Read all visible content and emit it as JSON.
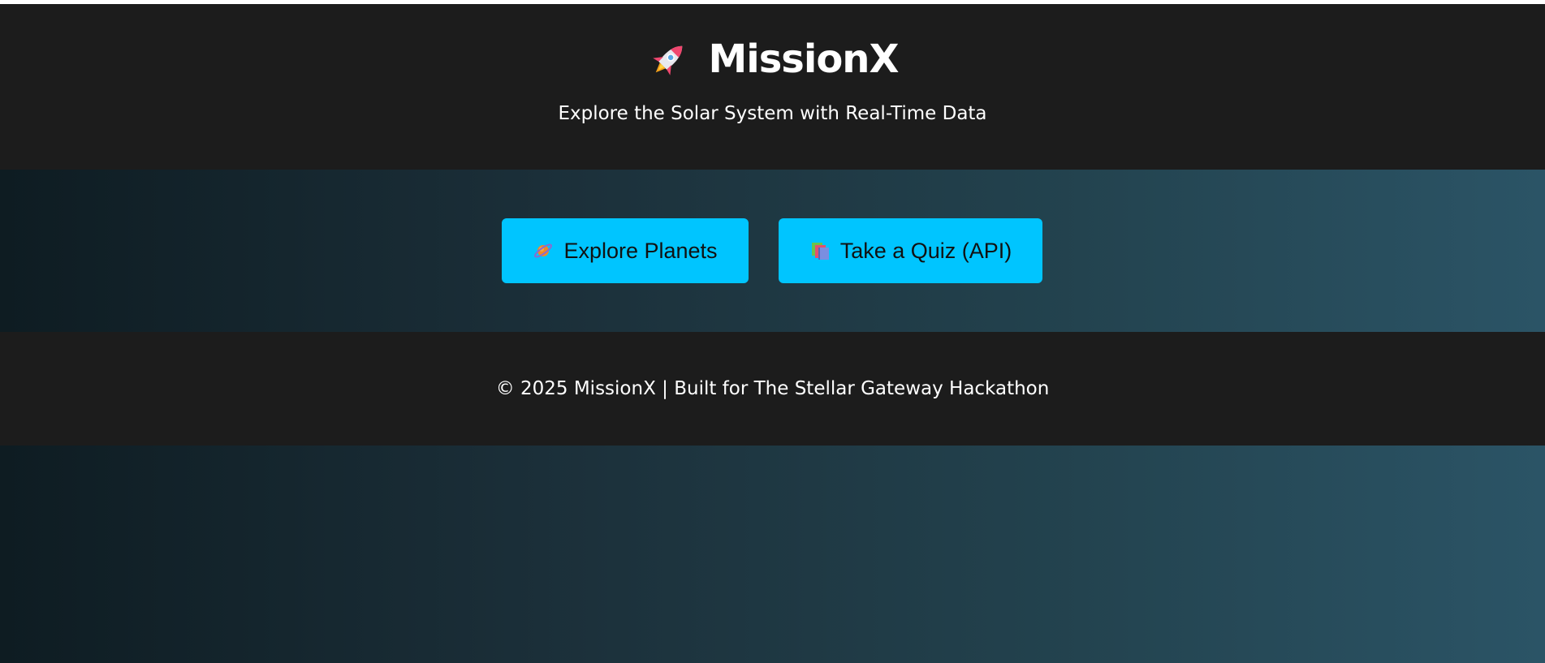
{
  "header": {
    "title": "MissionX",
    "subtitle": "Explore the Solar System with Real-Time Data",
    "icon": "rocket-icon"
  },
  "actions": {
    "explore_planets": {
      "label": "Explore Planets",
      "icon": "ringed-planet-icon"
    },
    "quiz": {
      "label": "Take a Quiz (API)",
      "icon": "books-icon"
    }
  },
  "footer": {
    "text": "© 2025 MissionX | Built for The Stellar Gateway Hackathon"
  },
  "colors": {
    "header_bg": "#1c1c1c",
    "button_bg": "#00c5ff",
    "gradient_start": "#0e1c22",
    "gradient_end": "#2b5466"
  }
}
